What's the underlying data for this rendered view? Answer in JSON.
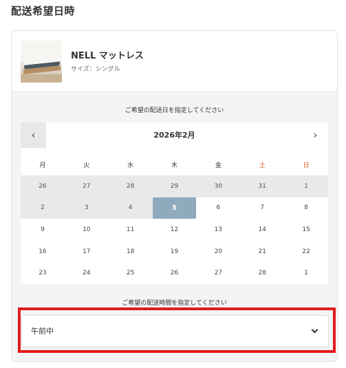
{
  "section": {
    "title": "配送希望日時"
  },
  "product": {
    "name": "NELL マットレス",
    "size": "サイズ：シングル"
  },
  "date_picker": {
    "prompt": "ご希望の配送日を指定してください",
    "month_label": "2026年2月",
    "prev_icon": "chevron-left-icon",
    "next_icon": "chevron-right-icon",
    "weekdays": [
      "月",
      "火",
      "水",
      "木",
      "金",
      "土",
      "日"
    ],
    "weekend_color": "#e2531b",
    "selected_color": "#8fa9bd",
    "weeks": [
      [
        {
          "day": "26",
          "state": "disabled"
        },
        {
          "day": "27",
          "state": "disabled"
        },
        {
          "day": "28",
          "state": "disabled"
        },
        {
          "day": "29",
          "state": "disabled"
        },
        {
          "day": "30",
          "state": "disabled"
        },
        {
          "day": "31",
          "state": "disabled"
        },
        {
          "day": "1",
          "state": "disabled"
        }
      ],
      [
        {
          "day": "2",
          "state": "disabled"
        },
        {
          "day": "3",
          "state": "disabled"
        },
        {
          "day": "4",
          "state": "disabled"
        },
        {
          "day": "5",
          "state": "selected"
        },
        {
          "day": "6",
          "state": "available"
        },
        {
          "day": "7",
          "state": "available"
        },
        {
          "day": "8",
          "state": "available"
        }
      ],
      [
        {
          "day": "9",
          "state": "available"
        },
        {
          "day": "10",
          "state": "available"
        },
        {
          "day": "11",
          "state": "available"
        },
        {
          "day": "12",
          "state": "available"
        },
        {
          "day": "13",
          "state": "available"
        },
        {
          "day": "14",
          "state": "available"
        },
        {
          "day": "15",
          "state": "available"
        }
      ],
      [
        {
          "day": "16",
          "state": "available"
        },
        {
          "day": "17",
          "state": "available"
        },
        {
          "day": "18",
          "state": "available"
        },
        {
          "day": "19",
          "state": "available"
        },
        {
          "day": "20",
          "state": "available"
        },
        {
          "day": "21",
          "state": "available"
        },
        {
          "day": "22",
          "state": "available"
        }
      ],
      [
        {
          "day": "23",
          "state": "available"
        },
        {
          "day": "24",
          "state": "available"
        },
        {
          "day": "25",
          "state": "available"
        },
        {
          "day": "26",
          "state": "available"
        },
        {
          "day": "27",
          "state": "available"
        },
        {
          "day": "28",
          "state": "available"
        },
        {
          "day": "1",
          "state": "available"
        }
      ]
    ]
  },
  "time_picker": {
    "prompt": "ご希望の配送時間を指定してください",
    "selected_value": "午前中",
    "icon": "chevron-down-icon"
  },
  "annotation": {
    "highlight_color": "#e21b1b"
  }
}
